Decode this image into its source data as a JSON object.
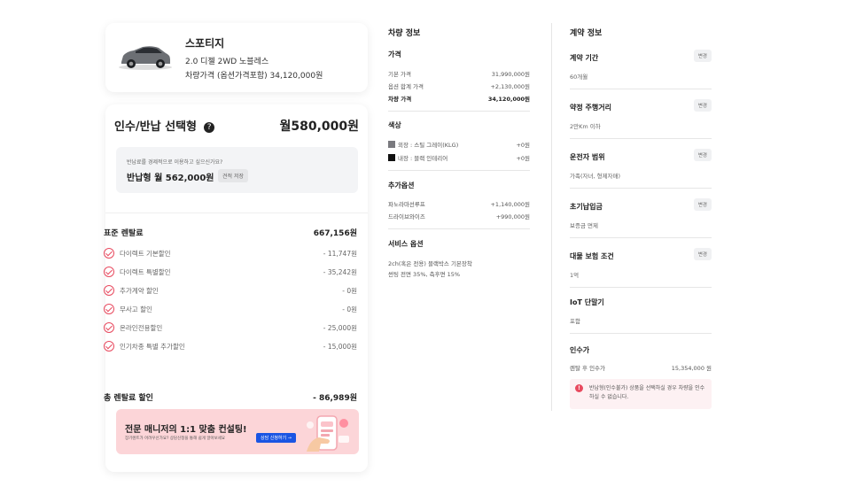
{
  "car": {
    "name": "스포티지",
    "trim": "2.0 디젤 2WD 노블레스",
    "price_line": "차량가격 (옵션가격포함)  34,120,000원"
  },
  "selection": {
    "title": "인수/반납 선택형",
    "help_icon": "?",
    "monthly": "월580,000원",
    "question": "반납료를 경제적으로 이용하고 싶으신가요?",
    "alt_type": "반납형   월 562,000원",
    "save_label": "견적 저장"
  },
  "standard": {
    "label": "표준 렌탈료",
    "value": "667,156원"
  },
  "discounts": [
    {
      "label": "다이렉트 기본할인",
      "value": "- 11,747원"
    },
    {
      "label": "다이렉트 특별할인",
      "value": "- 35,242원"
    },
    {
      "label": "추가계약 할인",
      "value": "- 0원"
    },
    {
      "label": "무사고 할인",
      "value": "- 0원"
    },
    {
      "label": "온라인전용할인",
      "value": "- 25,000원"
    },
    {
      "label": "인기차종 특별 추가할인",
      "value": "- 15,000원"
    }
  ],
  "total": {
    "label": "총 렌탈료 할인",
    "value": "- 86,989원"
  },
  "banner": {
    "title": "전문 매니저의 1:1 맞춤 컨설팅!",
    "subtitle": "장기렌트가 어려우신가요? 상담신청을 통해 쉽게 알아보세요",
    "button": "상담 신청하기 →"
  },
  "vehicle_info": {
    "title": "차량 정보",
    "price_section": "가격",
    "prices": [
      {
        "label": "기본 가격",
        "value": "31,990,000원",
        "bold": false
      },
      {
        "label": "옵션 합계 가격",
        "value": "+2,130,000원",
        "bold": false
      },
      {
        "label": "차량 가격",
        "value": "34,120,000원",
        "bold": true
      }
    ],
    "color_section": "색상",
    "colors": [
      {
        "label": "외장 : 스틸 그레이(KLG)",
        "value": "+0원",
        "swatch": "#7a7a7f"
      },
      {
        "label": "내장 : 블랙 인테리어",
        "value": "+0원",
        "swatch": "#111111"
      }
    ],
    "options_section": "추가옵션",
    "options": [
      {
        "label": "파노라마선루프",
        "value": "+1,140,000원"
      },
      {
        "label": "드라이브와이즈",
        "value": "+990,000원"
      }
    ],
    "service_section": "서비스 옵션",
    "service_lines": [
      "2ch(혹은 전용) 블랙박스 기본장착",
      "썬팅 전면 35%, 측후면 15%"
    ]
  },
  "contract_info": {
    "title": "계약 정보",
    "change_label": "변경",
    "items": [
      {
        "title": "계약 기간",
        "value": "60개월",
        "changeable": true
      },
      {
        "title": "약정 주행거리",
        "value": "2만Km 이하",
        "changeable": true
      },
      {
        "title": "운전자 범위",
        "value": "가족(자녀, 형제자매)",
        "changeable": true
      },
      {
        "title": "초기납입금",
        "value": "보증금 면제",
        "changeable": true
      },
      {
        "title": "대물 보험 조건",
        "value": "1억",
        "changeable": true
      },
      {
        "title": "IoT 단말기",
        "value": "포함",
        "changeable": false
      }
    ],
    "purchase_title": "인수가",
    "purchase_label": "렌탈 후 인수가",
    "purchase_value": "15,354,000 원",
    "warning": "반납형(인수불가) 상품을 선택하실 경우 차량을 인수하실 수 없습니다."
  },
  "colors": {
    "accent": "#e84a5f",
    "button_blue": "#1a55e3",
    "banner_bg": "#fcd5d8"
  }
}
